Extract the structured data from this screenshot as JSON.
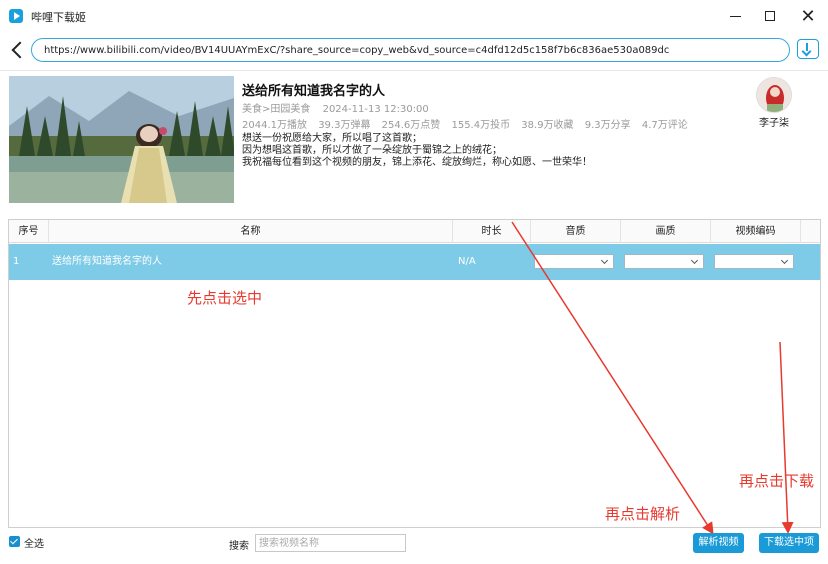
{
  "window": {
    "title": "哔哩下载姬",
    "minimize_label": "",
    "maximize_label": "",
    "close_label": "✕"
  },
  "urlbar": {
    "url": "https://www.bilibili.com/video/BV14UUAYmExC/?share_source=copy_web&vd_source=c4dfd12d5c158f7b6c836ae530a089dc"
  },
  "video": {
    "title": "送给所有知道我名字的人",
    "category": "美食>田园美食",
    "date": "2024-11-13 12:30:00",
    "stats": [
      "2044.1万播放",
      "39.3万弹幕",
      "254.6万点赞",
      "155.4万投币",
      "38.9万收藏",
      "9.3万分享",
      "4.7万评论"
    ],
    "description": [
      "想送一份祝愿给大家，所以唱了这首歌；",
      "因为想唱这首歌，所以才做了一朵绽放于蜀锦之上的绒花；",
      "我祝福每位看到这个视频的朋友，锦上添花、绽放绚烂，称心如愿、一世荣华！"
    ],
    "author": "李子柒"
  },
  "table": {
    "headers": [
      "序号",
      "名称",
      "时长",
      "音质",
      "画质",
      "视频编码"
    ],
    "rows": [
      {
        "index": "1",
        "name": "送给所有知道我名字的人",
        "duration": "N/A",
        "audio_quality": "",
        "video_quality": "",
        "codec": ""
      }
    ]
  },
  "annotations": {
    "step1": "先点击选中",
    "step2": "再点击解析",
    "step3": "再点击下载"
  },
  "bottom": {
    "select_all": "全选",
    "search_label": "搜索",
    "search_placeholder": "搜索视频名称",
    "parse_button": "解析视频",
    "download_button": "下载选中项"
  },
  "colors": {
    "accent": "#1a9ad6",
    "selected_row": "#7ecbe7",
    "annotation": "#e8392f"
  }
}
